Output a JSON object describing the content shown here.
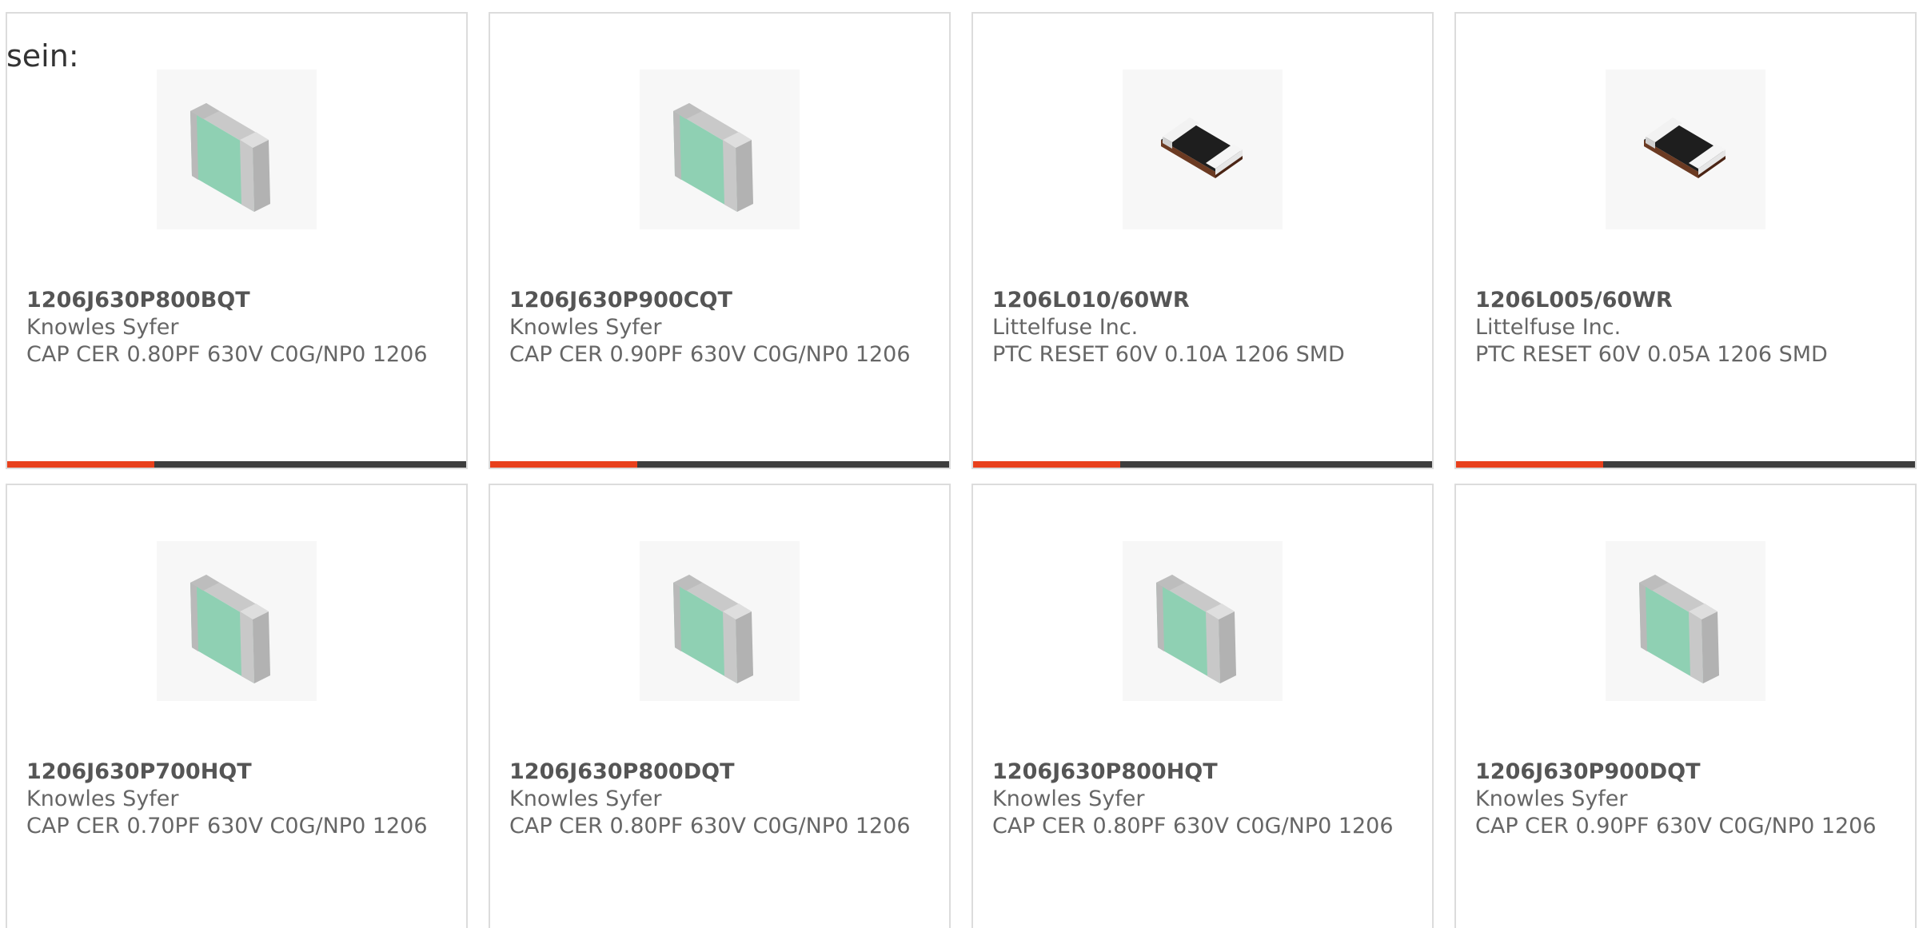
{
  "intro_text": "sein:",
  "accent_color": "#e8401c",
  "bar_track_color": "#3d3d3d",
  "products": [
    {
      "part_number": "1206J630P800BQT",
      "manufacturer": "Knowles Syfer",
      "description": "CAP CER 0.80PF 630V C0G/NP0 1206",
      "icon": "ceramic-capacitor-icon",
      "progress": 0.32
    },
    {
      "part_number": "1206J630P900CQT",
      "manufacturer": "Knowles Syfer",
      "description": "CAP CER 0.90PF 630V C0G/NP0 1206",
      "icon": "ceramic-capacitor-icon",
      "progress": 0.32
    },
    {
      "part_number": "1206L010/60WR",
      "manufacturer": "Littelfuse Inc.",
      "description": "PTC RESET 60V 0.10A 1206 SMD",
      "icon": "ptc-fuse-icon",
      "progress": 0.32
    },
    {
      "part_number": "1206L005/60WR",
      "manufacturer": "Littelfuse Inc.",
      "description": "PTC RESET 60V 0.05A 1206 SMD",
      "icon": "ptc-fuse-icon",
      "progress": 0.32
    },
    {
      "part_number": "1206J630P700HQT",
      "manufacturer": "Knowles Syfer",
      "description": "CAP CER 0.70PF 630V C0G/NP0 1206",
      "icon": "ceramic-capacitor-icon"
    },
    {
      "part_number": "1206J630P800DQT",
      "manufacturer": "Knowles Syfer",
      "description": "CAP CER 0.80PF 630V C0G/NP0 1206",
      "icon": "ceramic-capacitor-icon"
    },
    {
      "part_number": "1206J630P800HQT",
      "manufacturer": "Knowles Syfer",
      "description": "CAP CER 0.80PF 630V C0G/NP0 1206",
      "icon": "ceramic-capacitor-icon"
    },
    {
      "part_number": "1206J630P900DQT",
      "manufacturer": "Knowles Syfer",
      "description": "CAP CER 0.90PF 630V C0G/NP0 1206",
      "icon": "ceramic-capacitor-icon"
    }
  ]
}
